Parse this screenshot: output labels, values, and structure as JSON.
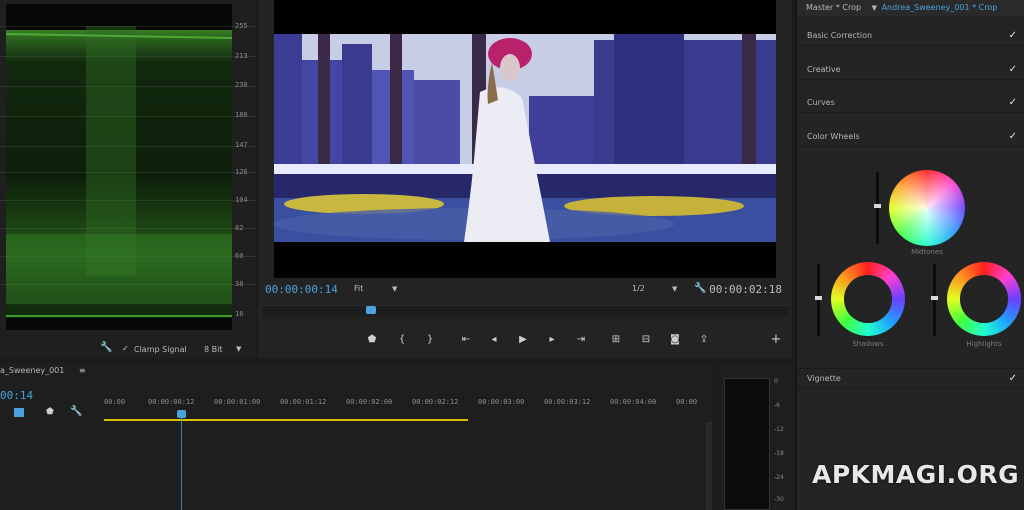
{
  "scope": {
    "ticks": [
      "255",
      "213",
      "230",
      "188",
      "147",
      "126",
      "104",
      "82",
      "60",
      "38",
      "16"
    ],
    "clamp_label": "Clamp Signal",
    "bit_depth": "8 Bit"
  },
  "monitor": {
    "timecode_current": "00:00:00:14",
    "timecode_duration": "00:00:02:18",
    "zoom": "Fit",
    "resolution": "1/2"
  },
  "lumetri": {
    "source_label": "Master * Crop",
    "clip_label": "Andrea_Sweeney_001 * Crop",
    "sections": [
      "Basic Correction",
      "Creative",
      "Curves",
      "Color Wheels"
    ],
    "wheels": [
      "Midtones",
      "Shadows",
      "Highlights"
    ],
    "vignette": "Vignette",
    "check": "✓"
  },
  "timeline": {
    "sequence_name": "a_Sweeney_001",
    "timecode": "00:14",
    "ruler": [
      "00:00",
      "00:00:00:12",
      "00:00:01:00",
      "00:00:01:12",
      "00:00:02:00",
      "00:00:02:12",
      "00:00:03:00",
      "00:00:03:12",
      "00:00:04:00",
      "00:00"
    ]
  },
  "meters": {
    "ticks": [
      "0",
      "-6",
      "-12",
      "-18",
      "-24",
      "-30"
    ]
  },
  "watermark": "APKMAGI.ORG",
  "colors": {
    "accent_blue": "#4aa3df",
    "work_area_yellow": "#d9c100"
  }
}
